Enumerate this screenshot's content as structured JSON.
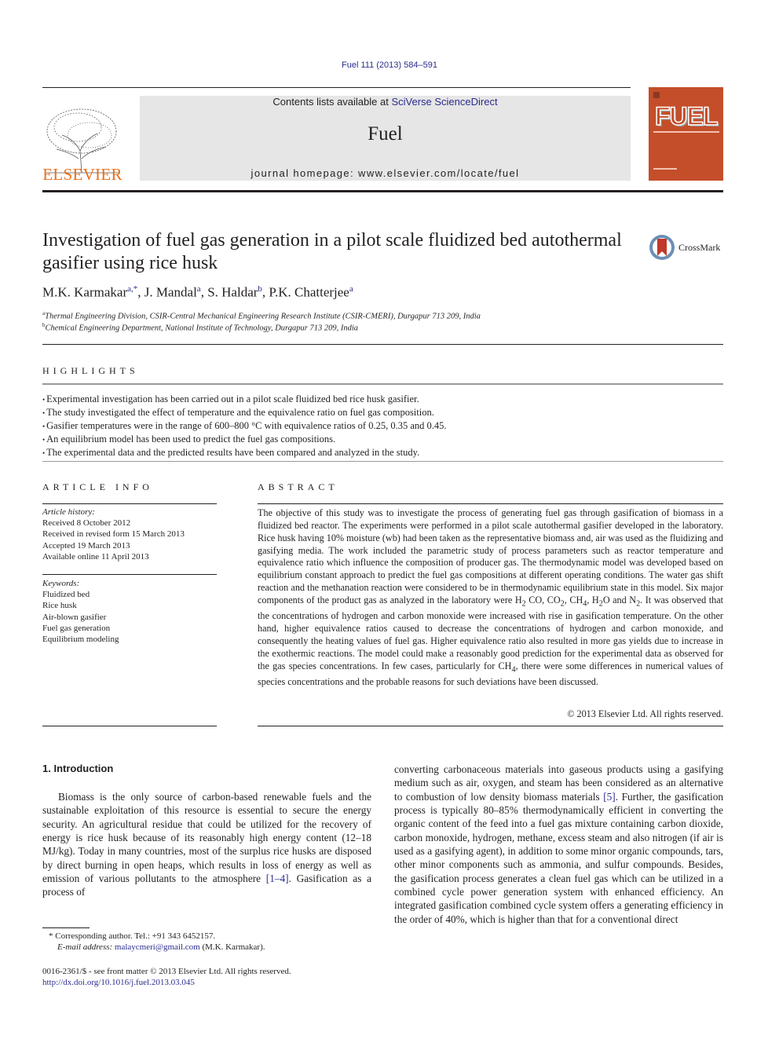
{
  "header": {
    "citation": "Fuel 111 (2013) 584–591",
    "contents_prefix": "Contents lists available at ",
    "contents_link": "SciVerse ScienceDirect",
    "journal_name": "Fuel",
    "homepage": "journal homepage: www.elsevier.com/locate/fuel",
    "publisher_logo_text": "ELSEVIER",
    "cover_title": "FUEL",
    "crossmark_label": "CrossMark"
  },
  "article": {
    "title": "Investigation of fuel gas generation in a pilot scale fluidized bed autothermal gasifier using rice husk",
    "authors": [
      {
        "name": "M.K. Karmakar",
        "sup": "a,*"
      },
      {
        "name": "J. Mandal",
        "sup": "a"
      },
      {
        "name": "S. Haldar",
        "sup": "b"
      },
      {
        "name": "P.K. Chatterjee",
        "sup": "a"
      }
    ],
    "affiliations": [
      {
        "sup": "a",
        "text": "Thermal Engineering Division, CSIR-Central Mechanical Engineering Research Institute (CSIR-CMERI), Durgapur 713 209, India"
      },
      {
        "sup": "b",
        "text": "Chemical Engineering Department, National Institute of Technology, Durgapur 713 209, India"
      }
    ]
  },
  "highlights": {
    "heading": "HIGHLIGHTS",
    "items": [
      "Experimental investigation has been carried out in a pilot scale fluidized bed rice husk gasifier.",
      "The study investigated the effect of temperature and the equivalence ratio on fuel gas composition.",
      "Gasifier temperatures were in the range of 600–800 °C with equivalence ratios of 0.25, 0.35 and 0.45.",
      "An equilibrium model has been used to predict the fuel gas compositions.",
      "The experimental data and the predicted results have been compared and analyzed in the study."
    ]
  },
  "article_info": {
    "heading": "ARTICLE INFO",
    "history_label": "Article history:",
    "history": [
      "Received 8 October 2012",
      "Received in revised form 15 March 2013",
      "Accepted 19 March 2013",
      "Available online 11 April 2013"
    ],
    "keywords_label": "Keywords:",
    "keywords": [
      "Fluidized bed",
      "Rice husk",
      "Air-blown gasifier",
      "Fuel gas generation",
      "Equilibrium modeling"
    ]
  },
  "abstract": {
    "heading": "ABSTRACT",
    "text_1": "The objective of this study was to investigate the process of generating fuel gas through gasification of biomass in a fluidized bed reactor. The experiments were performed in a pilot scale autothermal gasifier developed in the laboratory. Rice husk having 10% moisture (wb) had been taken as the representative biomass and, air was used as the fluidizing and gasifying media. The work included the parametric study of process parameters such as reactor temperature and equivalence ratio which influence the composition of producer gas. The thermodynamic model was developed based on equilibrium constant approach to predict the fuel gas compositions at different operating conditions. The water gas shift reaction and the methanation reaction were considered to be in thermodynamic equilibrium state in this model. Six major components of the product gas as analyzed in the laboratory were H",
    "text_2": " CO, CO",
    "text_3": ", CH",
    "text_4": ", H",
    "text_5": "O and N",
    "text_6": ". It was observed that the concentrations of hydrogen and carbon monoxide were increased with rise in gasification temperature. On the other hand, higher equivalence ratios caused to decrease the concentrations of hydrogen and carbon monoxide, and consequently the heating values of fuel gas. Higher equivalence ratio also resulted in more gas yields due to increase in the exothermic reactions. The model could make a reasonably good prediction for the experimental data as observed for the gas species concentrations. In few cases, particularly for CH",
    "text_7": ", there were some differences in numerical values of species concentrations and the probable reasons for such deviations have been discussed.",
    "sub_2": "2",
    "sub_4": "4",
    "copyright": "© 2013 Elsevier Ltd. All rights reserved."
  },
  "introduction": {
    "heading": "1. Introduction",
    "left_1": "Biomass is the only source of carbon-based renewable fuels and the sustainable exploitation of this resource is essential to secure the energy security. An agricultural residue that could be utilized for the recovery of energy is rice husk because of its reasonably high energy content (12–18 MJ/kg). Today in many countries, most of the surplus rice husks are disposed by direct burning in open heaps, which results in loss of energy as well as emission of various pollutants to the atmosphere ",
    "left_ref": "[1–4]",
    "left_2": ". Gasification as a process of",
    "right_1": "converting carbonaceous materials into gaseous products using a gasifying medium such as air, oxygen, and steam has been considered as an alternative to combustion of low density biomass materials ",
    "right_ref": "[5]",
    "right_2": ". Further, the gasification process is typically 80–85% thermodynamically efficient in converting the organic content of the feed into a fuel gas mixture containing carbon dioxide, carbon monoxide, hydrogen, methane, excess steam and also nitrogen (if air is used as a gasifying agent), in addition to some minor organic compounds, tars, other minor components such as ammonia, and sulfur compounds. Besides, the gasification process generates a clean fuel gas which can be utilized in a combined cycle power generation system with enhanced efficiency. An integrated gasification combined cycle system offers a generating efficiency in the order of 40%, which is higher than that for a conventional direct"
  },
  "footnotes": {
    "corresponding": "* Corresponding author. Tel.: +91 343 6452157.",
    "email_label": "E-mail address:",
    "email": "malaycmeri@gmail.com",
    "email_suffix": " (M.K. Karmakar).",
    "issn": "0016-2361/$ - see front matter © 2013 Elsevier Ltd. All rights reserved.",
    "doi": "http://dx.doi.org/10.1016/j.fuel.2013.03.045"
  }
}
